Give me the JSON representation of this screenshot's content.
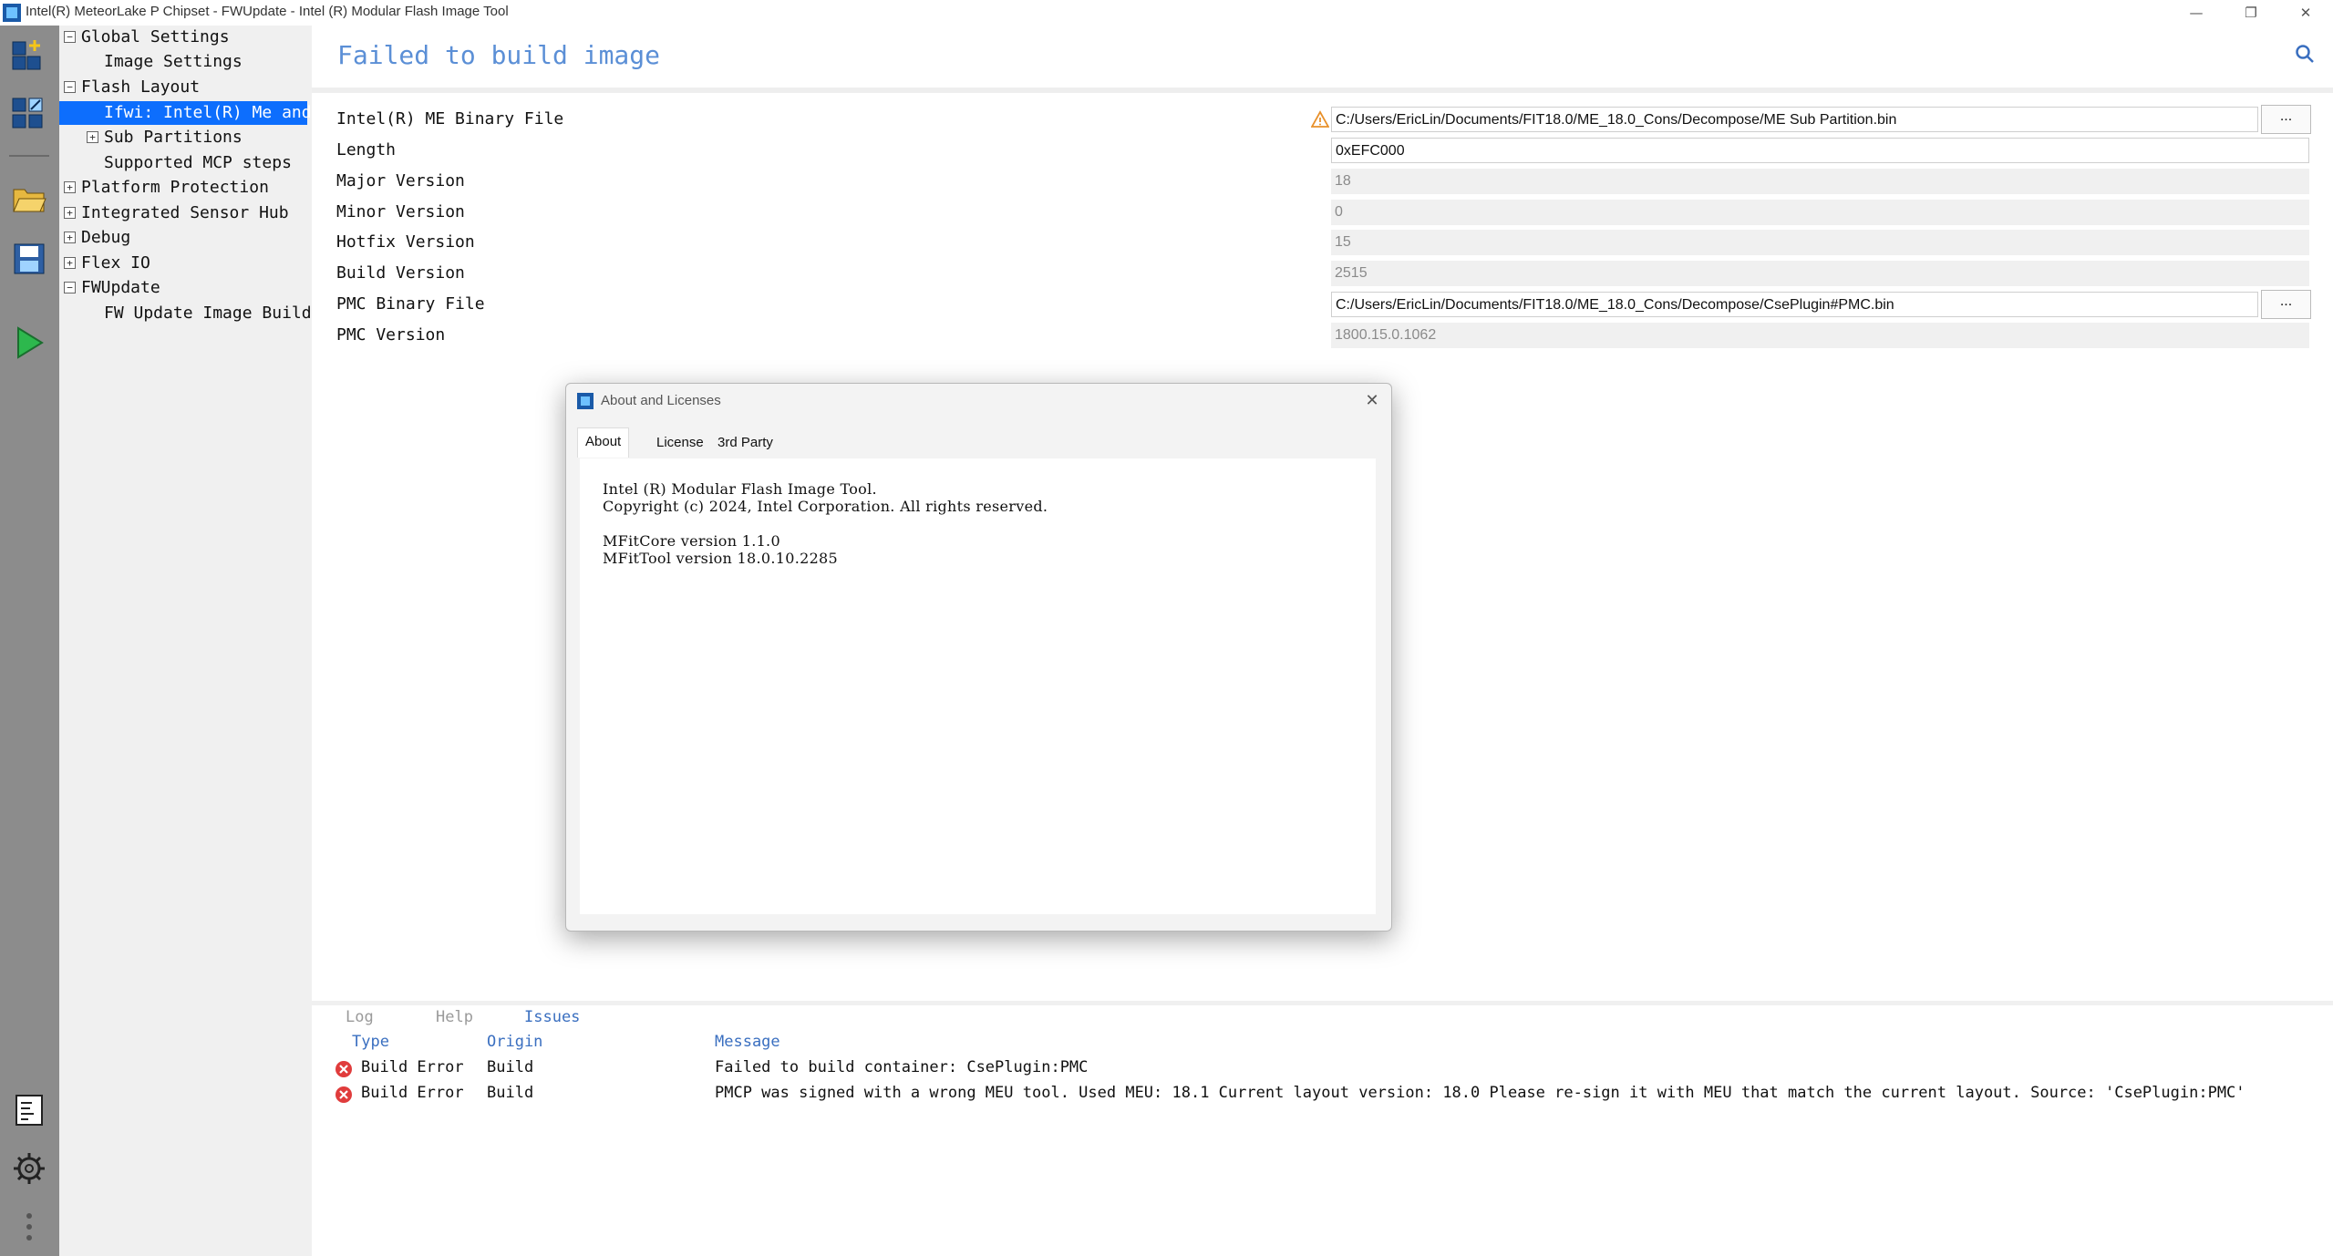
{
  "window": {
    "title": "Intel(R) MeteorLake P Chipset - FWUpdate - Intel (R) Modular Flash Image Tool",
    "minimize": "—",
    "restore": "❐",
    "close": "✕"
  },
  "tree": {
    "items": [
      {
        "label": "Global Settings",
        "expander": "−"
      },
      {
        "label": "Image Settings"
      },
      {
        "label": "Flash Layout",
        "expander": "−"
      },
      {
        "label": "Ifwi: Intel(R) Me and "
      },
      {
        "label": "Sub Partitions",
        "expander": "+"
      },
      {
        "label": "Supported MCP steps"
      },
      {
        "label": "Platform Protection",
        "expander": "+"
      },
      {
        "label": "Integrated Sensor Hub",
        "expander": "+"
      },
      {
        "label": "Debug",
        "expander": "+"
      },
      {
        "label": "Flex IO",
        "expander": "+"
      },
      {
        "label": "FWUpdate",
        "expander": "−"
      },
      {
        "label": "FW Update Image Build"
      }
    ]
  },
  "header": {
    "title": "Failed to build image"
  },
  "properties": [
    {
      "label": "Intel(R) ME Binary File",
      "value": "C:/Users/EricLin/Documents/FIT18.0/ME_18.0_Cons/Decompose/ME Sub Partition.bin",
      "browse": "..."
    },
    {
      "label": "Length",
      "value": "0xEFC000"
    },
    {
      "label": "Major Version",
      "value": "18"
    },
    {
      "label": "Minor Version",
      "value": "0"
    },
    {
      "label": "Hotfix Version",
      "value": "15"
    },
    {
      "label": "Build Version",
      "value": "2515"
    },
    {
      "label": "PMC Binary  File",
      "value": "C:/Users/EricLin/Documents/FIT18.0/ME_18.0_Cons/Decompose/CsePlugin#PMC.bin",
      "browse": "..."
    },
    {
      "label": "PMC  Version",
      "value": "1800.15.0.1062"
    }
  ],
  "dialog": {
    "title": "About and Licenses",
    "close": "✕",
    "tabs": [
      "About",
      "License",
      "3rd Party"
    ],
    "lines": [
      "Intel (R) Modular Flash Image Tool.",
      "Copyright (c) 2024, Intel Corporation. All rights reserved.",
      "MFitCore version 1.1.0",
      "MFitTool version 18.0.10.2285"
    ]
  },
  "bottom": {
    "tabs": [
      "Log",
      "Help",
      "Issues"
    ],
    "columns": [
      "Type",
      "Origin",
      "Message"
    ],
    "rows": [
      {
        "type": "Build Error",
        "origin": "Build",
        "message": "Failed to build container: CsePlugin:PMC"
      },
      {
        "type": "Build Error",
        "origin": "Build",
        "message": "PMCP was signed with a wrong MEU tool. Used MEU: 18.1 Current layout version: 18.0 Please re-sign it with MEU that match the current layout.  Source: 'CsePlugin:PMC'"
      }
    ]
  },
  "colors": {
    "accent": "#5b8fd6",
    "selection": "#0d6efd",
    "error": "#e03c3c",
    "warning": "#e8902a",
    "rail": "#8c8c8c"
  }
}
